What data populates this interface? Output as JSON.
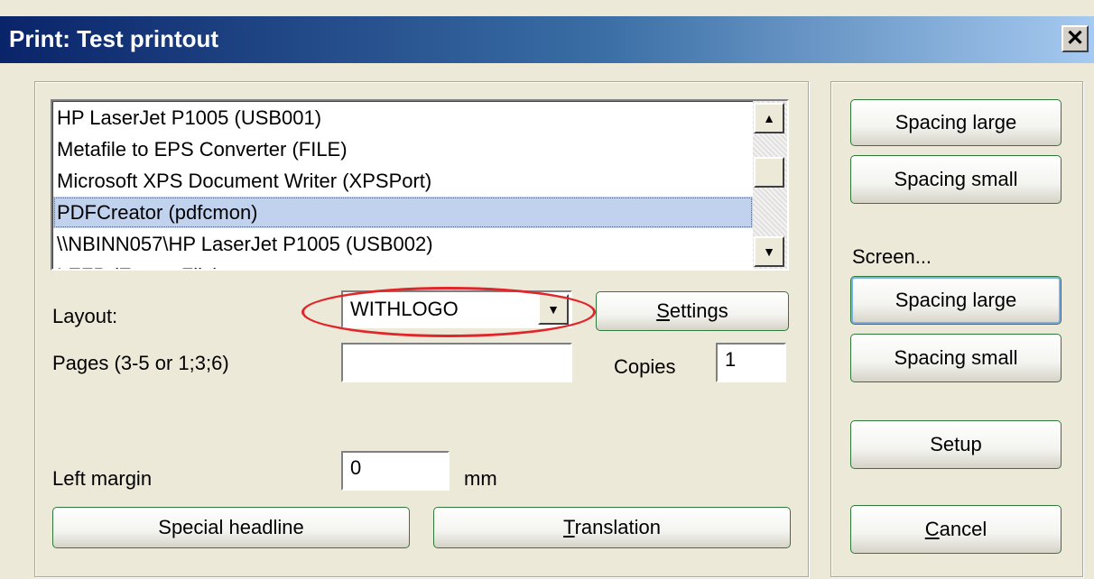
{
  "window": {
    "title": "Print: Test printout",
    "close_glyph": "✕"
  },
  "printers": {
    "items": [
      {
        "label": "HP LaserJet P1005 (USB001)",
        "selected": false
      },
      {
        "label": "Metafile to EPS Converter (FILE)",
        "selected": false
      },
      {
        "label": "Microsoft XPS Document Writer (XPSPort)",
        "selected": false
      },
      {
        "label": "PDFCreator (pdfcmon)",
        "selected": true
      },
      {
        "label": "\\\\NBINN057\\HP LaserJet P1005 (USB002)",
        "selected": false
      },
      {
        "label": "LEFP (Export File)",
        "selected": false
      }
    ]
  },
  "layout": {
    "label": "Layout:",
    "value": "WITHLOGO",
    "settings_button": "Settings",
    "settings_mnemonic": "S"
  },
  "pages": {
    "label": "Pages (3-5 or 1;3;6)",
    "value": ""
  },
  "copies": {
    "label": "Copies",
    "value": "1"
  },
  "margin": {
    "label": "Left margin",
    "value": "0",
    "unit": "mm"
  },
  "buttons": {
    "special_headline": "Special headline",
    "translation": "Translation",
    "translation_mnemonic": "T"
  },
  "right_panel": {
    "print_spacing_large": "Spacing large",
    "print_spacing_small": "Spacing small",
    "screen_label": "Screen...",
    "screen_spacing_large": "Spacing large",
    "screen_spacing_small": "Spacing small",
    "setup": "Setup",
    "cancel": "Cancel",
    "cancel_mnemonic": "C"
  },
  "colors": {
    "title_gradient_start": "#0a246a",
    "button_border": "#2f7a3a",
    "highlight": "#e0262a",
    "selection": "#c1d2ee"
  }
}
